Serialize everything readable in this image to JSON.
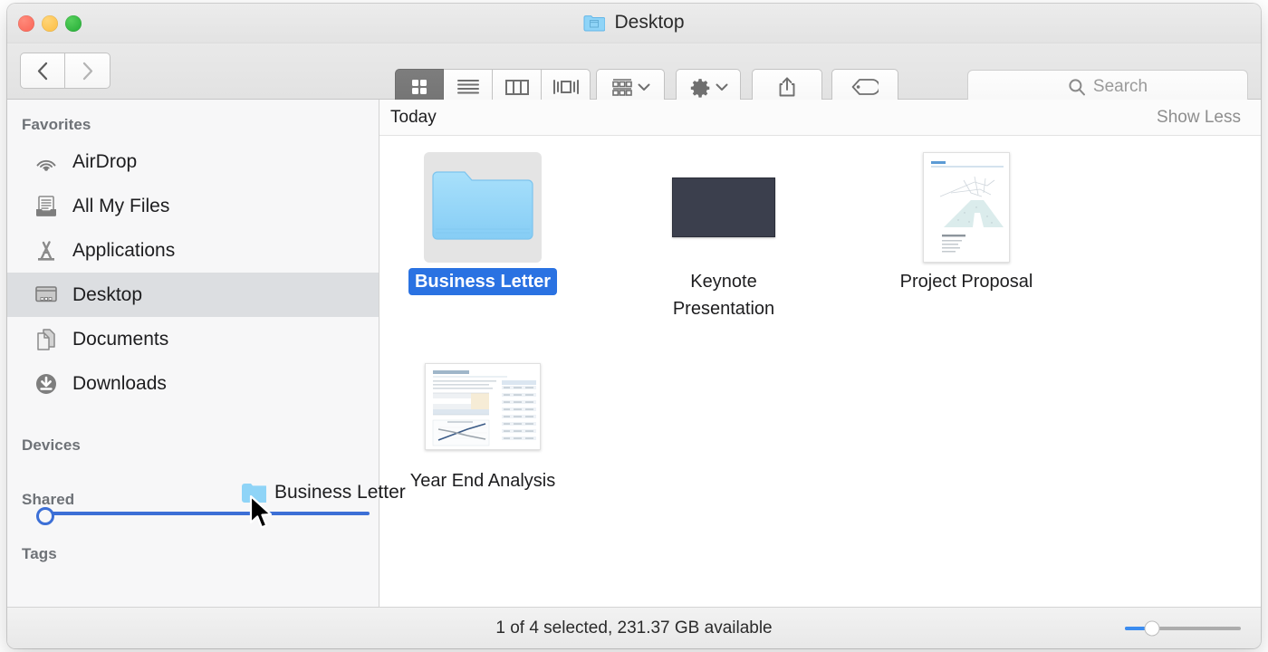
{
  "window": {
    "title": "Desktop",
    "title_icon": "folder-icon",
    "traffic_lights": [
      {
        "name": "close",
        "color": "#fa6355"
      },
      {
        "name": "minimize",
        "color": "#fcbd40"
      },
      {
        "name": "zoom",
        "color": "#23ab35"
      }
    ]
  },
  "toolbar": {
    "back_icon": "chevron-left-icon",
    "forward_icon": "chevron-right-icon",
    "view_modes": [
      {
        "name": "icon-view",
        "icon": "grid-icon",
        "active": true
      },
      {
        "name": "list-view",
        "icon": "list-icon",
        "active": false
      },
      {
        "name": "column-view",
        "icon": "columns-icon",
        "active": false
      },
      {
        "name": "coverflow-view",
        "icon": "coverflow-icon",
        "active": false
      }
    ],
    "arrange": {
      "icon": "arrange-icon",
      "chevron": "chevron-down-icon"
    },
    "action": {
      "icon": "gear-icon",
      "chevron": "chevron-down-icon"
    },
    "share": {
      "icon": "share-icon"
    },
    "tags": {
      "icon": "tag-icon"
    }
  },
  "search": {
    "icon": "search-icon",
    "placeholder": "Search",
    "value": ""
  },
  "sidebar": {
    "sections": [
      {
        "header": "Favorites",
        "items": [
          {
            "label": "AirDrop",
            "icon": "airdrop-icon",
            "selected": false
          },
          {
            "label": "All My Files",
            "icon": "all-my-files-icon",
            "selected": false
          },
          {
            "label": "Applications",
            "icon": "applications-icon",
            "selected": false
          },
          {
            "label": "Desktop",
            "icon": "desktop-icon",
            "selected": true
          },
          {
            "label": "Documents",
            "icon": "documents-icon",
            "selected": false
          },
          {
            "label": "Downloads",
            "icon": "downloads-icon",
            "selected": false
          }
        ]
      },
      {
        "header": "Devices",
        "items": []
      },
      {
        "header": "Shared",
        "items": []
      },
      {
        "header": "Tags",
        "items": []
      }
    ],
    "drop_indicator": {
      "visible": true,
      "color": "#3c6fd6"
    },
    "drag_ghost": {
      "label": "Business Letter",
      "icon": "folder-icon"
    }
  },
  "content": {
    "group_title": "Today",
    "group_action": "Show Less",
    "files": [
      {
        "name": "Business Letter",
        "kind": "folder",
        "selected": true
      },
      {
        "name": "Keynote Presentation",
        "kind": "keynote",
        "selected": false
      },
      {
        "name": "Project Proposal",
        "kind": "pages",
        "selected": false
      },
      {
        "name": "Year End Analysis",
        "kind": "numbers",
        "selected": false
      }
    ]
  },
  "statusbar": {
    "text": "1 of 4 selected, 231.37 GB available",
    "zoom_slider": {
      "name": "icon-size-slider",
      "value": 22,
      "accent": "#3b8cf0"
    }
  }
}
